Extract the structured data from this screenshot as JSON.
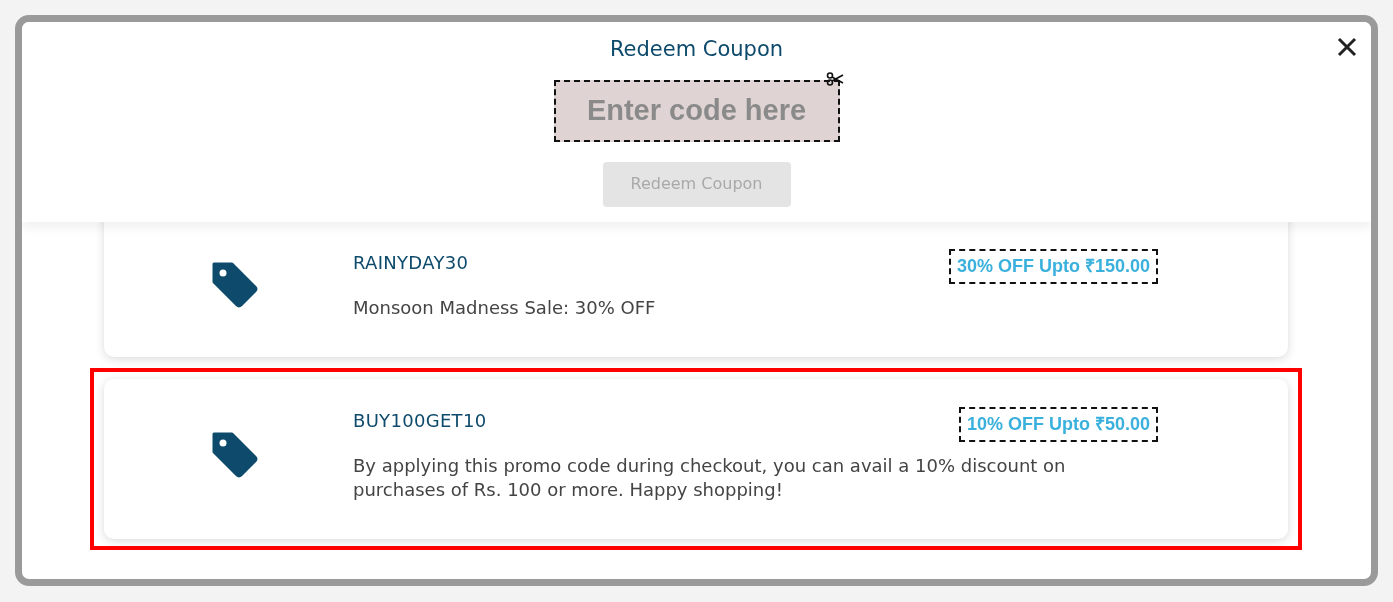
{
  "dialog": {
    "title": "Redeem Coupon",
    "code_field": {
      "placeholder": "Enter code here"
    },
    "redeem_button": {
      "label": "Redeem Coupon",
      "disabled": true
    }
  },
  "coupons": [
    {
      "code": "RAINYDAY30",
      "description": "Monsoon Madness Sale: 30% OFF",
      "offer": "30% OFF Upto ₹150.00",
      "highlighted": false
    },
    {
      "code": "BUY100GET10",
      "description": "By applying this promo code during checkout, you can avail a 10% discount on purchases of Rs. 100 or more. Happy shopping!",
      "offer": "10% OFF Upto ₹50.00",
      "highlighted": true
    }
  ]
}
